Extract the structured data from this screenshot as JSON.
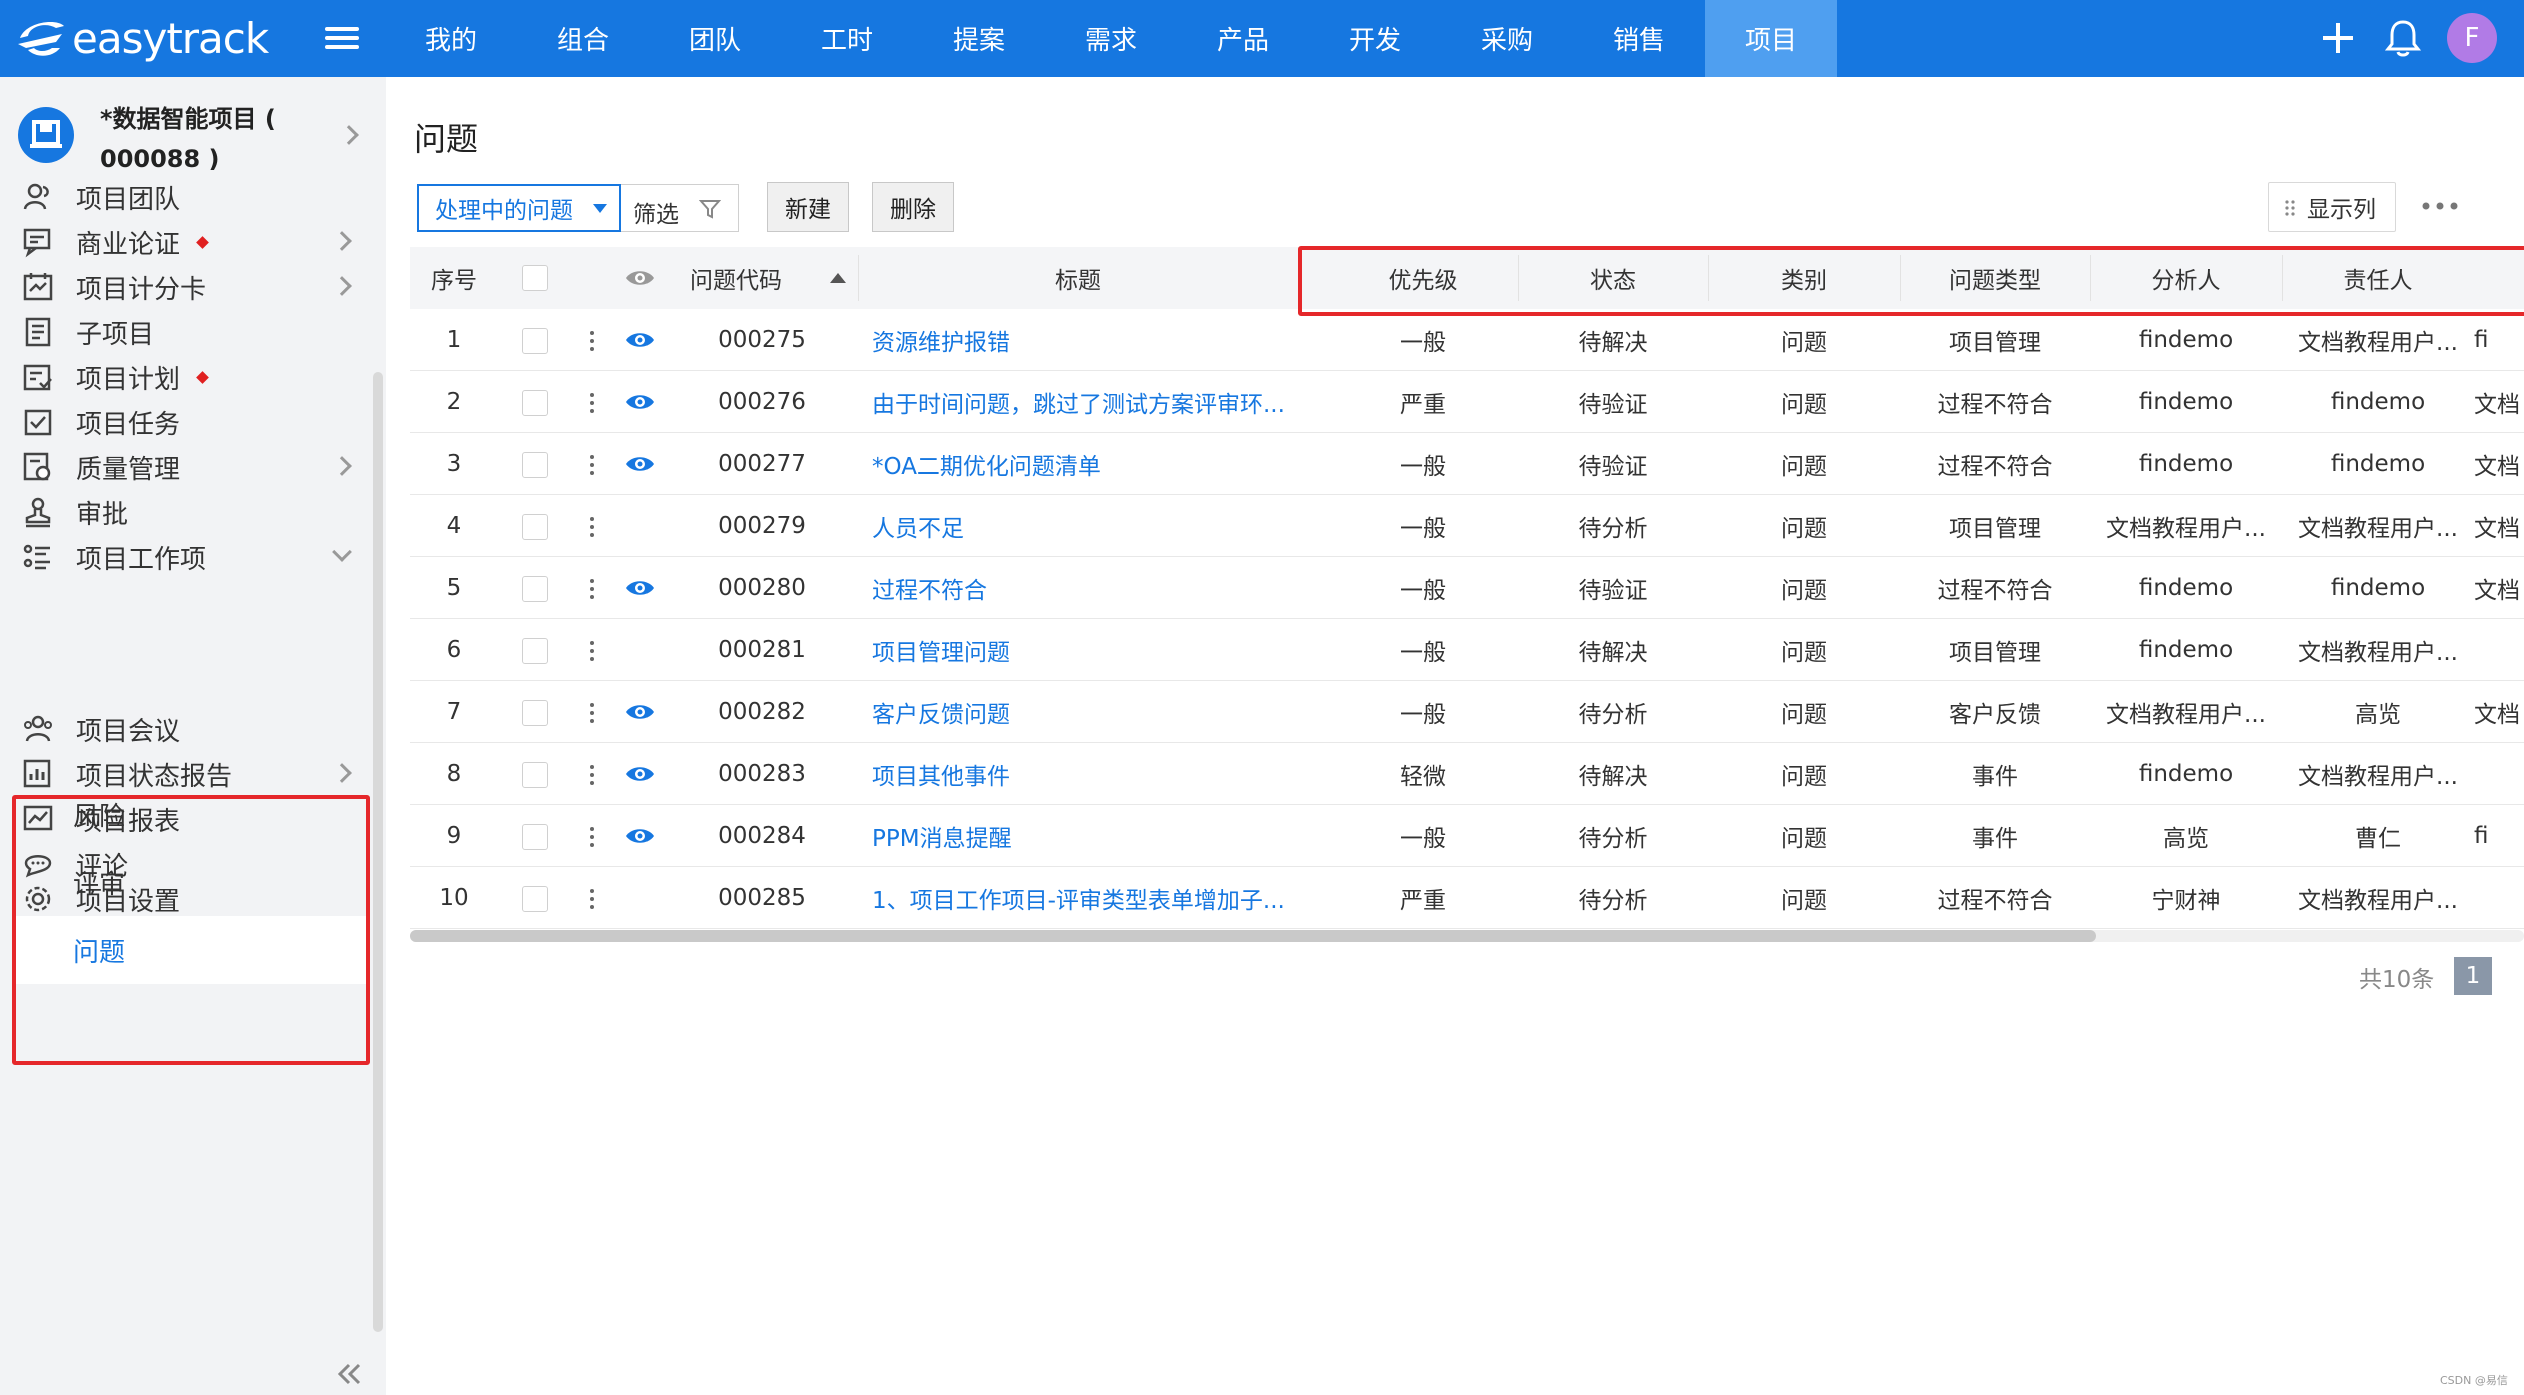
{
  "app": {
    "logo_text": "easytrack",
    "avatar_letter": "F"
  },
  "nav": {
    "items": [
      "我的",
      "组合",
      "团队",
      "工时",
      "提案",
      "需求",
      "产品",
      "开发",
      "采购",
      "销售",
      "项目"
    ],
    "active": "项目"
  },
  "sidebar": {
    "project_name": "*数据智能项目 ( 000088 )",
    "items": [
      {
        "label": "项目团队",
        "icon": "team-icon"
      },
      {
        "label": "商业论证",
        "icon": "business-case-icon"
      },
      {
        "label": "项目计分卡",
        "icon": "scorecard-icon"
      },
      {
        "label": "子项目",
        "icon": "subproject-icon"
      },
      {
        "label": "项目计划",
        "icon": "plan-icon"
      },
      {
        "label": "项目任务",
        "icon": "task-icon"
      },
      {
        "label": "质量管理",
        "icon": "quality-icon"
      },
      {
        "label": "审批",
        "icon": "approval-icon"
      },
      {
        "label": "项目工作项",
        "icon": "workitem-icon"
      },
      {
        "label": "项目会议",
        "icon": "meeting-icon"
      },
      {
        "label": "项目状态报告",
        "icon": "status-report-icon"
      },
      {
        "label": "项目报表",
        "icon": "report-icon"
      },
      {
        "label": "评论",
        "icon": "comment-icon"
      },
      {
        "label": "项目设置",
        "icon": "settings-icon"
      }
    ],
    "sub_items": [
      "风险",
      "评审",
      "问题"
    ],
    "active_sub": "问题"
  },
  "main": {
    "title": "问题",
    "view_select": "处理中的问题",
    "filter_label": "筛选",
    "new_button": "新建",
    "delete_button": "删除",
    "show_columns": "显示列",
    "total": "共10条",
    "page": "1"
  },
  "table": {
    "headers": [
      "序号",
      "问题代码",
      "标题",
      "优先级",
      "状态",
      "类别",
      "问题类型",
      "分析人",
      "责任人"
    ],
    "rows": [
      {
        "no": "1",
        "code": "000275",
        "title": "资源维护报错",
        "priority": "一般",
        "status": "待解决",
        "category": "问题",
        "type": "项目管理",
        "analyst": "findemo",
        "owner": "文档教程用户...",
        "extra": "fi",
        "eye": true
      },
      {
        "no": "2",
        "code": "000276",
        "title": "由于时间问题，跳过了测试方案评审环...",
        "priority": "严重",
        "status": "待验证",
        "category": "问题",
        "type": "过程不符合",
        "analyst": "findemo",
        "owner": "findemo",
        "extra": "文档",
        "eye": true
      },
      {
        "no": "3",
        "code": "000277",
        "title": "*OA二期优化问题清单",
        "priority": "一般",
        "status": "待验证",
        "category": "问题",
        "type": "过程不符合",
        "analyst": "findemo",
        "owner": "findemo",
        "extra": "文档",
        "eye": true
      },
      {
        "no": "4",
        "code": "000279",
        "title": "人员不足",
        "priority": "一般",
        "status": "待分析",
        "category": "问题",
        "type": "项目管理",
        "analyst": "文档教程用户...",
        "owner": "文档教程用户...",
        "extra": "文档",
        "eye": false
      },
      {
        "no": "5",
        "code": "000280",
        "title": "过程不符合",
        "priority": "一般",
        "status": "待验证",
        "category": "问题",
        "type": "过程不符合",
        "analyst": "findemo",
        "owner": "findemo",
        "extra": "文档",
        "eye": true
      },
      {
        "no": "6",
        "code": "000281",
        "title": "项目管理问题",
        "priority": "一般",
        "status": "待解决",
        "category": "问题",
        "type": "项目管理",
        "analyst": "findemo",
        "owner": "文档教程用户...",
        "extra": "",
        "eye": false
      },
      {
        "no": "7",
        "code": "000282",
        "title": "客户反馈问题",
        "priority": "一般",
        "status": "待分析",
        "category": "问题",
        "type": "客户反馈",
        "analyst": "文档教程用户...",
        "owner": "高览",
        "extra": "文档",
        "eye": true
      },
      {
        "no": "8",
        "code": "000283",
        "title": "项目其他事件",
        "priority": "轻微",
        "status": "待解决",
        "category": "问题",
        "type": "事件",
        "analyst": "findemo",
        "owner": "文档教程用户...",
        "extra": "",
        "eye": true
      },
      {
        "no": "9",
        "code": "000284",
        "title": "PPM消息提醒",
        "priority": "一般",
        "status": "待分析",
        "category": "问题",
        "type": "事件",
        "analyst": "高览",
        "owner": "曹仁",
        "extra": "fi",
        "eye": true
      },
      {
        "no": "10",
        "code": "000285",
        "title": "1、项目工作项目-评审类型表单增加子...",
        "priority": "严重",
        "status": "待分析",
        "category": "问题",
        "type": "过程不符合",
        "analyst": "宁财神",
        "owner": "文档教程用户...",
        "extra": "",
        "eye": false
      }
    ]
  },
  "colors": {
    "brand": "#1677e0",
    "highlight": "#e5272a"
  },
  "watermark": "CSDN @易信"
}
